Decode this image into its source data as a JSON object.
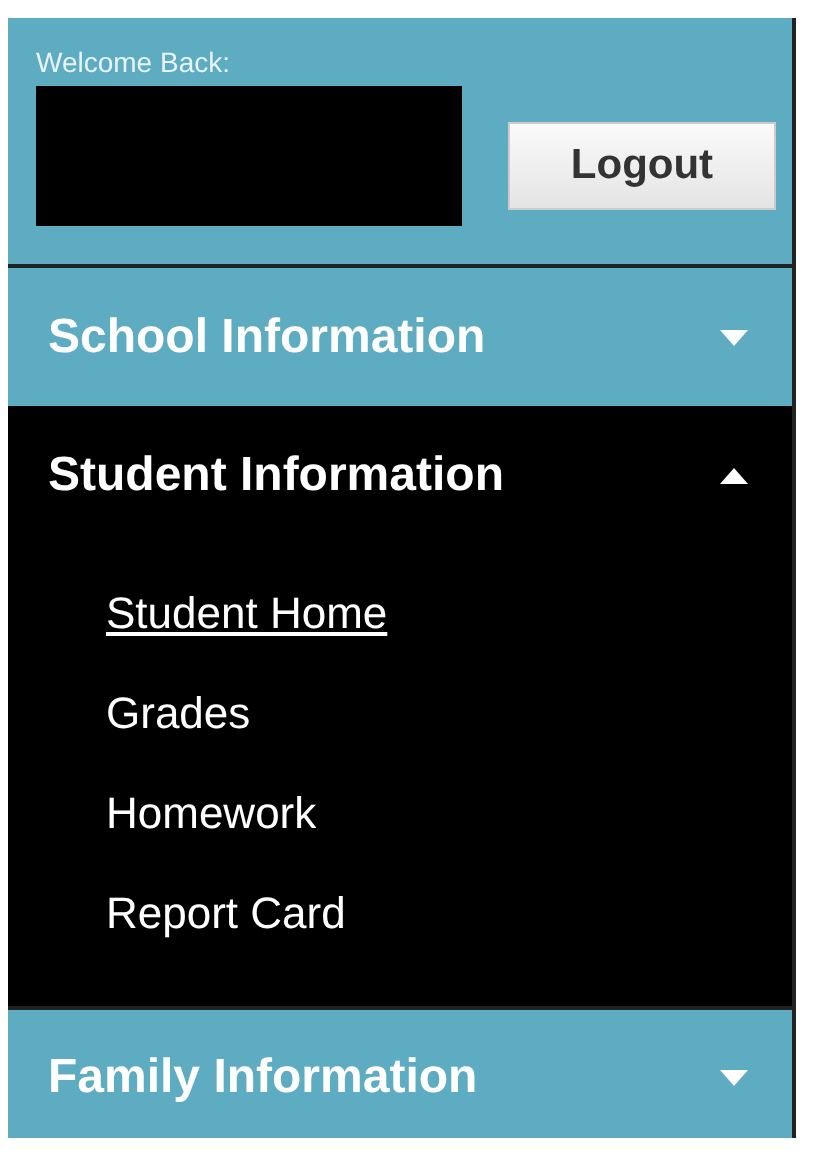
{
  "header": {
    "welcome": "Welcome Back:",
    "name_redacted": true,
    "logout_button": "Logout"
  },
  "sections": [
    {
      "title": "School Information",
      "expanded": false
    },
    {
      "title": "Student Information",
      "expanded": true,
      "items": [
        {
          "label": "Student Home",
          "selected": true
        },
        {
          "label": "Grades",
          "selected": false
        },
        {
          "label": "Homework",
          "selected": false
        },
        {
          "label": "Report Card",
          "selected": false
        }
      ]
    },
    {
      "title": "Family Information",
      "expanded": false
    }
  ]
}
